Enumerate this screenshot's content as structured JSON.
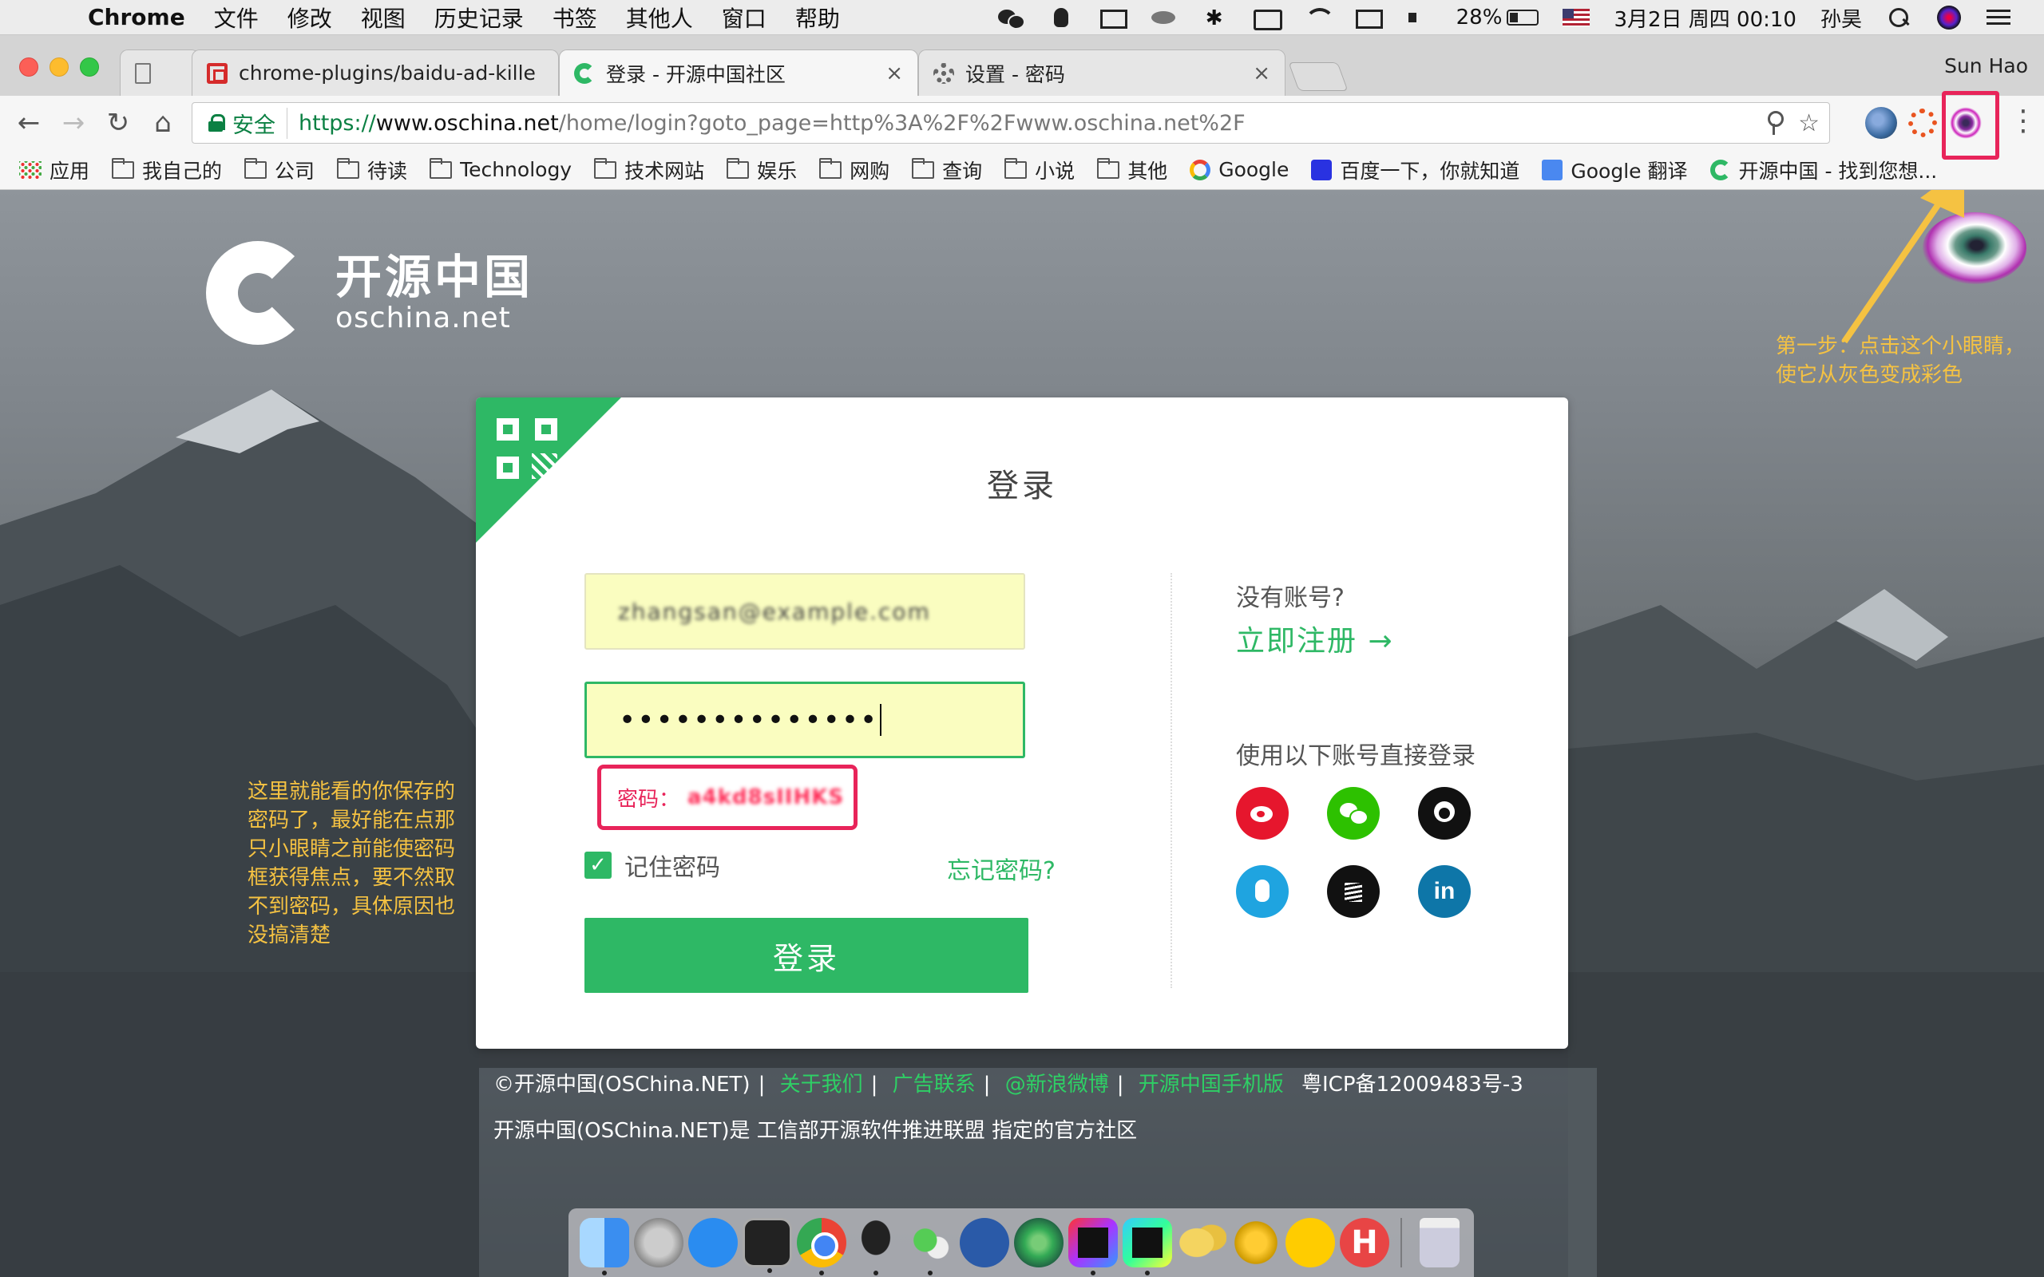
{
  "menubar": {
    "app_name": "Chrome",
    "items": [
      "文件",
      "修改",
      "视图",
      "历史记录",
      "书签",
      "其他人",
      "窗口",
      "帮助"
    ],
    "battery": "28%",
    "datetime": "3月2日 周四  00:10",
    "user": "孙昊"
  },
  "tabs": [
    {
      "title": "",
      "icon": "doc-icon"
    },
    {
      "title": "chrome-plugins/baidu-ad-kille",
      "icon": "github-red-icon"
    },
    {
      "title": "登录 - 开源中国社区",
      "icon": "oschina-icon"
    },
    {
      "title": "设置 - 密码",
      "icon": "gear-icon"
    }
  ],
  "profile_name": "Sun Hao",
  "omnibox": {
    "secure_label": "安全",
    "scheme": "https://",
    "host": "www.oschina.net",
    "path": "/home/login?goto_page=http%3A%2F%2Fwww.oschina.net%2F"
  },
  "bookmarks": [
    {
      "label": "应用",
      "icon": "apps-icon"
    },
    {
      "label": "我自己的",
      "icon": "folder-icon"
    },
    {
      "label": "公司",
      "icon": "folder-icon"
    },
    {
      "label": "待读",
      "icon": "folder-icon"
    },
    {
      "label": "Technology",
      "icon": "folder-icon"
    },
    {
      "label": "技术网站",
      "icon": "folder-icon"
    },
    {
      "label": "娱乐",
      "icon": "folder-icon"
    },
    {
      "label": "网购",
      "icon": "folder-icon"
    },
    {
      "label": "查询",
      "icon": "folder-icon"
    },
    {
      "label": "小说",
      "icon": "folder-icon"
    },
    {
      "label": "其他",
      "icon": "folder-icon"
    },
    {
      "label": "Google",
      "icon": "google-icon"
    },
    {
      "label": "百度一下，你就知道",
      "icon": "baidu-icon"
    },
    {
      "label": "Google 翻译",
      "icon": "google-translate-icon"
    },
    {
      "label": "开源中国 - 找到您想...",
      "icon": "oschina-icon"
    }
  ],
  "logo": {
    "cn": "开源中国",
    "en": "oschina.net"
  },
  "login": {
    "title": "登录",
    "username_value": "zhangsan@example.com",
    "password_dots": "••••••••••••••",
    "reveal_label": "密码：",
    "reveal_value": "a4kd8sIIHKS",
    "remember_label": "记住密码",
    "forgot_label": "忘记密码?",
    "submit_label": "登录",
    "no_account": "没有账号?",
    "register": "立即注册 →",
    "social_title": "使用以下账号直接登录"
  },
  "social": [
    "weibo",
    "wechat",
    "github",
    "qq",
    "stackoverflow",
    "linkedin"
  ],
  "footer": {
    "copyright": "©开源中国(OSChina.NET)",
    "links": [
      "关于我们",
      "广告联系",
      "@新浪微博",
      "开源中国手机版"
    ],
    "icp": "粤ICP备12009483号-3",
    "line2": "开源中国(OSChina.NET)是 工信部开源软件推进联盟 指定的官方社区"
  },
  "annotations": {
    "right": "第一步：点击这个小眼睛，使它从灰色变成彩色",
    "left": "这里就能看的你保存的密码了，最好能在点那只小眼睛之前能使密码框获得焦点，要不然取不到密码，具体原因也没搞清楚"
  },
  "colors": {
    "brand_green": "#2eb865",
    "annotation_yellow": "#f5c242",
    "highlight_red": "#e8245a"
  },
  "dock": [
    "finder",
    "launchpad",
    "app-store",
    "terminal",
    "chrome",
    "qq",
    "wechat",
    "sourcetree",
    "atom",
    "intellij",
    "webstorm",
    "cheese",
    "instruments",
    "qq-music",
    "h-app",
    "trash"
  ]
}
